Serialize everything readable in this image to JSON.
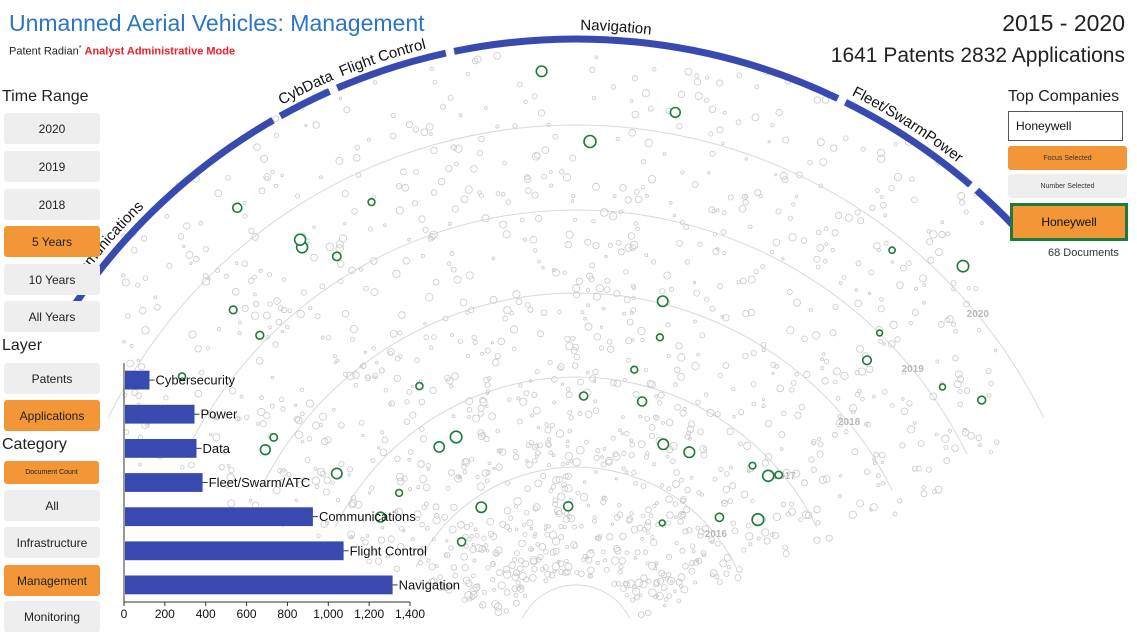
{
  "header": {
    "title": "Unmanned Aerial Vehicles: Management",
    "brand": "Patent Radian",
    "brand_mark": "*",
    "mode": "Analyst Administrative Mode",
    "year_range": "2015 - 2020",
    "counts": "1641 Patents 2832 Applications"
  },
  "time_range": {
    "label": "Time Range",
    "options": [
      "2020",
      "2019",
      "2018",
      "5 Years",
      "10 Years",
      "All Years"
    ],
    "selected": "5 Years"
  },
  "layer": {
    "label": "Layer",
    "options": [
      "Patents",
      "Applications"
    ],
    "selected": "Applications"
  },
  "category": {
    "label": "Category",
    "document_count": "Document Count",
    "options": [
      "All",
      "Infrastructure",
      "Management",
      "Monitoring"
    ],
    "selected": "Management"
  },
  "top_companies": {
    "label": "Top Companies",
    "input_value": "Honeywell",
    "focus_selected": "Focus Selected",
    "number_selected": "Number Selected",
    "selected_company": "Honeywell",
    "documents": "68 Documents"
  },
  "colors": {
    "title": "#2a75c4",
    "accent_orange": "#f39638",
    "arc_blue": "#3a49b0",
    "bar_blue": "#3a49b0",
    "highlight_green": "#1e7a3a",
    "mode_red": "#e8202a"
  },
  "chart_data": [
    {
      "type": "scatter",
      "description_type": "radial year-ring dot plot",
      "sectors": [
        "Communications",
        "CybData",
        "Flight Control",
        "Navigation",
        "Fleet/SwarmPower"
      ],
      "rings": [
        "2016",
        "2017",
        "2018",
        "2019",
        "2020"
      ],
      "point_count_highlighted": 41
    },
    {
      "type": "bar",
      "orientation": "horizontal",
      "categories": [
        "Cybersecurity",
        "Power",
        "Data",
        "Fleet/Swarm/ATC",
        "Communications",
        "Flight Control",
        "Navigation"
      ],
      "values": [
        120,
        340,
        350,
        380,
        920,
        1070,
        1310
      ],
      "xlim": [
        0,
        1400
      ],
      "xticks": [
        "0",
        "200",
        "400",
        "600",
        "800",
        "1,000",
        "1,200",
        "1,400"
      ]
    }
  ]
}
